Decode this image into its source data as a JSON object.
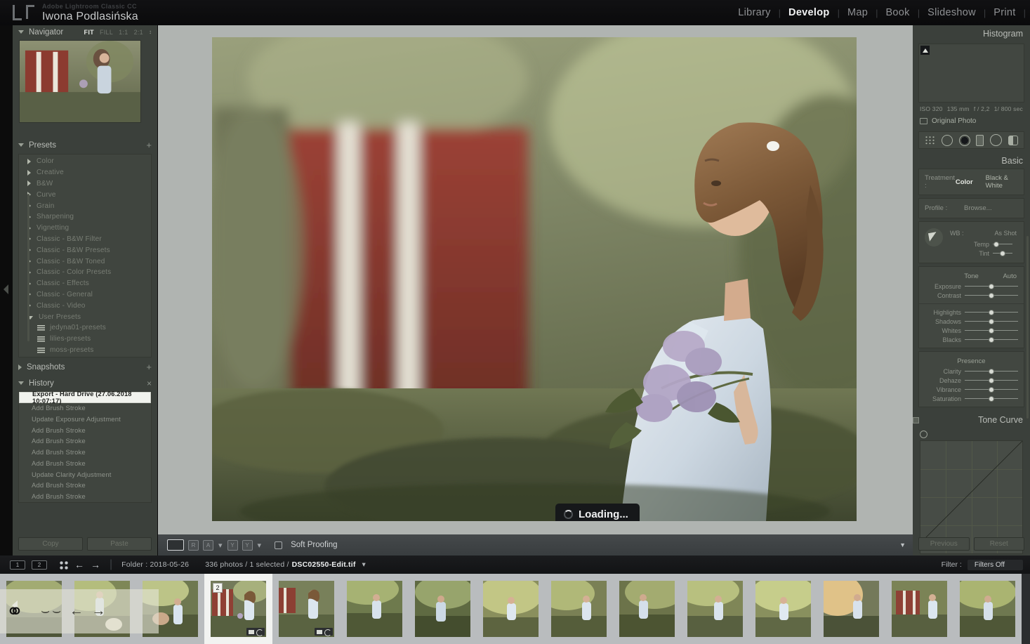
{
  "app": {
    "sub_title": "Adobe Lightroom Classic CC",
    "user_name": "Iwona Podlasińska",
    "logo_icon": "lr-logo-icon"
  },
  "modules": [
    {
      "label": "Library",
      "active": false
    },
    {
      "label": "Develop",
      "active": true
    },
    {
      "label": "Map",
      "active": false
    },
    {
      "label": "Book",
      "active": false
    },
    {
      "label": "Slideshow",
      "active": false
    },
    {
      "label": "Print",
      "active": false
    }
  ],
  "module_separator": "|",
  "navigator": {
    "title": "Navigator",
    "zoom_levels": [
      "FIT",
      "FILL",
      "1:1",
      "2:1"
    ],
    "active_zoom": "FIT",
    "caret": "↕"
  },
  "presets": {
    "title": "Presets",
    "add_icon": "+",
    "groups": [
      {
        "label": "Color",
        "expanded": false
      },
      {
        "label": "Creative",
        "expanded": false
      },
      {
        "label": "B&W",
        "expanded": false
      },
      {
        "label": "Curve",
        "expanded": false
      },
      {
        "label": "Grain",
        "expanded": false
      },
      {
        "label": "Sharpening",
        "expanded": false
      },
      {
        "label": "Vignetting",
        "expanded": false
      },
      {
        "label": "Classic - B&W Filter",
        "expanded": false
      },
      {
        "label": "Classic - B&W Presets",
        "expanded": false
      },
      {
        "label": "Classic - B&W Toned",
        "expanded": false
      },
      {
        "label": "Classic - Color Presets",
        "expanded": false
      },
      {
        "label": "Classic - Effects",
        "expanded": false
      },
      {
        "label": "Classic - General",
        "expanded": false
      },
      {
        "label": "Classic - Video",
        "expanded": false
      },
      {
        "label": "User Presets",
        "expanded": true
      }
    ],
    "user_presets": [
      {
        "label": "jedyna01-presets"
      },
      {
        "label": "lilies-presets"
      },
      {
        "label": "moss-presets"
      }
    ]
  },
  "snapshots": {
    "title": "Snapshots",
    "add_icon": "+"
  },
  "history": {
    "title": "History",
    "close_icon": "×",
    "items": [
      {
        "label": "Export - Hard Drive (27.06.2018 10:07:17)",
        "selected": true
      },
      {
        "label": "Add Brush Stroke",
        "selected": false
      },
      {
        "label": "Update Exposure Adjustment",
        "selected": false
      },
      {
        "label": "Add Brush Stroke",
        "selected": false
      },
      {
        "label": "Add Brush Stroke",
        "selected": false
      },
      {
        "label": "Add Brush Stroke",
        "selected": false
      },
      {
        "label": "Add Brush Stroke",
        "selected": false
      },
      {
        "label": "Update Clarity Adjustment",
        "selected": false
      },
      {
        "label": "Add Brush Stroke",
        "selected": false
      },
      {
        "label": "Add Brush Stroke",
        "selected": false
      }
    ]
  },
  "left_buttons": {
    "copy": "Copy",
    "paste": "Paste"
  },
  "center": {
    "loading_text": "Loading...",
    "loading_spinner_icon": "spinner-icon",
    "cursor_icon": "brush-cursor-icon"
  },
  "toolbar": {
    "loupe_view_icon": "loupe-view-icon",
    "before_after_icon": "before-after-icon",
    "before_after_label_left": "R",
    "before_after_label_right": "A",
    "compare_icon": "compare-icon",
    "compare_label_left": "Y",
    "compare_label_right": "Y",
    "dot": "▾",
    "soft_proofing_label": "Soft Proofing",
    "soft_proofing_checked": false,
    "overflow_caret": "▼"
  },
  "histogram": {
    "title": "Histogram",
    "clip_shadow_icon": "shadow-clipping-icon",
    "exif": {
      "iso": "ISO 320",
      "focal": "135 mm",
      "aperture": "f / 2,2",
      "shutter": "1/ 800 sec"
    },
    "original_photo_label": "Original Photo",
    "original_photo_icon": "original-photo-icon"
  },
  "tools": [
    {
      "name": "crop-overlay-icon"
    },
    {
      "name": "spot-removal-icon"
    },
    {
      "name": "red-eye-icon"
    },
    {
      "name": "graduated-filter-icon"
    },
    {
      "name": "radial-filter-icon"
    },
    {
      "name": "adjustment-brush-icon"
    }
  ],
  "basic": {
    "title": "Basic",
    "treatment_label": "Treatment :",
    "treatment_color": "Color",
    "treatment_bw": "Black & White",
    "profile_label": "Profile :",
    "profile_value": "Browse...",
    "profile_swatch_icon": "profile-grid-icon",
    "wb_label": "WB :",
    "wb_value": "As Shot",
    "eyedropper_icon": "white-balance-selector-icon",
    "wb_sliders": [
      {
        "name": "Temp",
        "pos": 18
      },
      {
        "name": "Tint",
        "pos": 50
      }
    ],
    "tone_title": "Tone",
    "auto_label": "Auto",
    "tone_sliders": [
      {
        "name": "Exposure",
        "pos": 50
      },
      {
        "name": "Contrast",
        "pos": 50
      },
      {
        "name": "Highlights",
        "pos": 50
      },
      {
        "name": "Shadows",
        "pos": 50
      },
      {
        "name": "Whites",
        "pos": 50
      },
      {
        "name": "Blacks",
        "pos": 50
      }
    ],
    "presence_title": "Presence",
    "presence_sliders": [
      {
        "name": "Clarity",
        "pos": 50
      },
      {
        "name": "Dehaze",
        "pos": 50
      },
      {
        "name": "Vibrance",
        "pos": 50
      },
      {
        "name": "Saturation",
        "pos": 50
      }
    ]
  },
  "tone_curve": {
    "title": "Tone Curve",
    "toggle_icon": "panel-switch-icon",
    "target_adjust_icon": "target-adjustment-icon"
  },
  "right_buttons": {
    "previous": "Previous",
    "reset": "Reset"
  },
  "filmstrip_bar": {
    "page1": "1",
    "page2": "2",
    "grid_icon": "grid-view-icon",
    "back_icon": "←",
    "forward_icon": "→",
    "separator": "|",
    "folder_label": "Folder : 2018-05-26",
    "count_label": "336 photos / 1 selected /",
    "filename": "DSC02550-Edit.tif",
    "filename_caret": "▾",
    "filter_label": "Filter :",
    "filter_value": "Filters Off"
  },
  "filmstrip": {
    "selected_index": 3,
    "selected_badge": "2",
    "thumbs": [
      {
        "scene": "a"
      },
      {
        "scene": "b"
      },
      {
        "scene": "c"
      },
      {
        "scene": "d"
      },
      {
        "scene": "e"
      },
      {
        "scene": "f"
      },
      {
        "scene": "g"
      },
      {
        "scene": "h"
      },
      {
        "scene": "i"
      },
      {
        "scene": "j"
      },
      {
        "scene": "k"
      },
      {
        "scene": "l"
      },
      {
        "scene": "m"
      },
      {
        "scene": "n"
      },
      {
        "scene": "o"
      }
    ],
    "watermark_text": "⌣⌣ ← →"
  },
  "colors": {
    "panel_bg": "#3b403b",
    "center_bg": "#b0b4b1",
    "accent_text": "#e6e9e3",
    "topbar_bg": "#0e0f11"
  }
}
